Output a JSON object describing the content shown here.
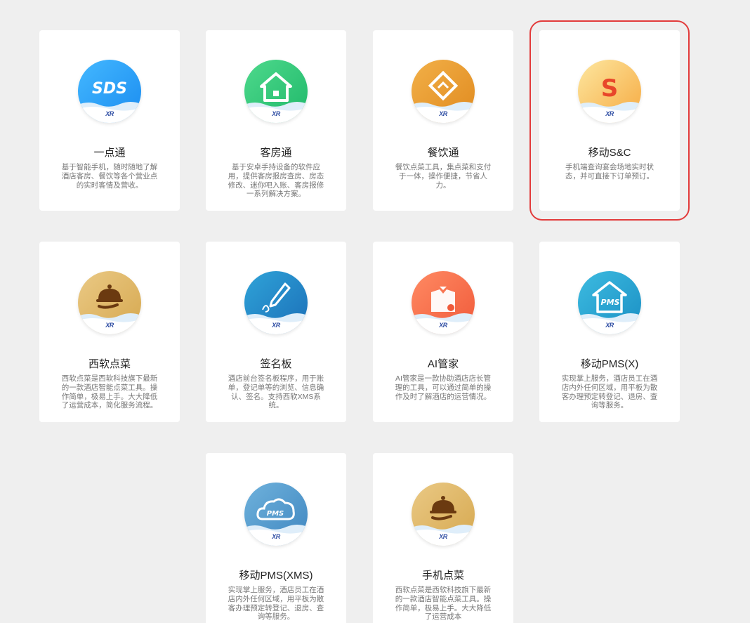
{
  "apps": [
    {
      "title": "一点通",
      "desc": "基于智能手机，随时随地了解酒店客房、餐饮等各个营业点的实时客情及营收。",
      "icon": "sds-logo-icon",
      "glyph": "SDS",
      "color_a": "#1a8cf0",
      "color_b": "#44b8ff",
      "badge": "XR",
      "selected": false
    },
    {
      "title": "客房通",
      "desc": "基于安卓手持设备的软件应用，提供客房报房查房、房态修改、迷你吧入账、客房报修一系列解决方案。",
      "icon": "house-icon",
      "glyph": "",
      "color_a": "#1fb86a",
      "color_b": "#4ed98c",
      "badge": "XR",
      "selected": false
    },
    {
      "title": "餐饮通",
      "desc": "餐饮点菜工具，集点菜和支付于一体，操作便捷，节省人力。",
      "icon": "diamond-icon",
      "glyph": "",
      "color_a": "#e08a1f",
      "color_b": "#f2b048",
      "badge": "XR",
      "selected": false
    },
    {
      "title": "移动S&C",
      "desc": "手机端查询宴会场地实时状态，并可直接下订单预订。",
      "icon": "s-letter-icon",
      "glyph": "S",
      "color_a": "#f6a940",
      "color_b": "#fde7a0",
      "badge": "XR",
      "selected": true
    },
    {
      "title": "西软点菜",
      "desc": "西软点菜是西软科技旗下最新的一款酒店智能点菜工具。操作简单，极易上手。大大降低了运营成本，简化服务流程。",
      "icon": "cloche-icon",
      "glyph": "",
      "color_a": "#d6a84f",
      "color_b": "#eac985",
      "badge": "XR",
      "selected": false
    },
    {
      "title": "签名板",
      "desc": "酒店前台签名板程序，用于账单，登记单等的浏览、信息确认、签名。支持西软XMS系统。",
      "icon": "pen-icon",
      "glyph": "",
      "color_a": "#1b6fb8",
      "color_b": "#2fa3d8",
      "badge": "XR",
      "selected": false
    },
    {
      "title": "AI管家",
      "desc": "AI管家是一款协助酒店店长管理的工具，可以通过简单的操作及时了解酒店的运营情况。",
      "icon": "butler-icon",
      "glyph": "",
      "color_a": "#f05a3a",
      "color_b": "#ff8a63",
      "badge": "XR",
      "selected": false
    },
    {
      "title": "移动PMS(X)",
      "desc": "实现掌上服务，酒店员工在酒店内外任何区域，用平板为散客办理预定转登记、退房、查询等服务。",
      "icon": "pms-house-icon",
      "glyph": "PMS",
      "color_a": "#1a8fc4",
      "color_b": "#3dbbe0",
      "badge": "XR",
      "selected": false
    },
    {
      "title": "移动PMS(XMS)",
      "desc": "实现掌上服务，酒店员工在酒店内外任何区域，用平板为散客办理预定转登记、退房、查询等服务。",
      "icon": "pms-cloud-icon",
      "glyph": "PMS",
      "color_a": "#3f86c0",
      "color_b": "#6fb2dc",
      "badge": "XR",
      "selected": false
    },
    {
      "title": "手机点菜",
      "desc": "西软点菜是西软科技旗下最新的一款酒店智能点菜工具。操作简单，极易上手。大大降低了运营成本",
      "icon": "cloche-icon",
      "glyph": "",
      "color_a": "#d6a84f",
      "color_b": "#eac985",
      "badge": "XR",
      "selected": false
    }
  ]
}
